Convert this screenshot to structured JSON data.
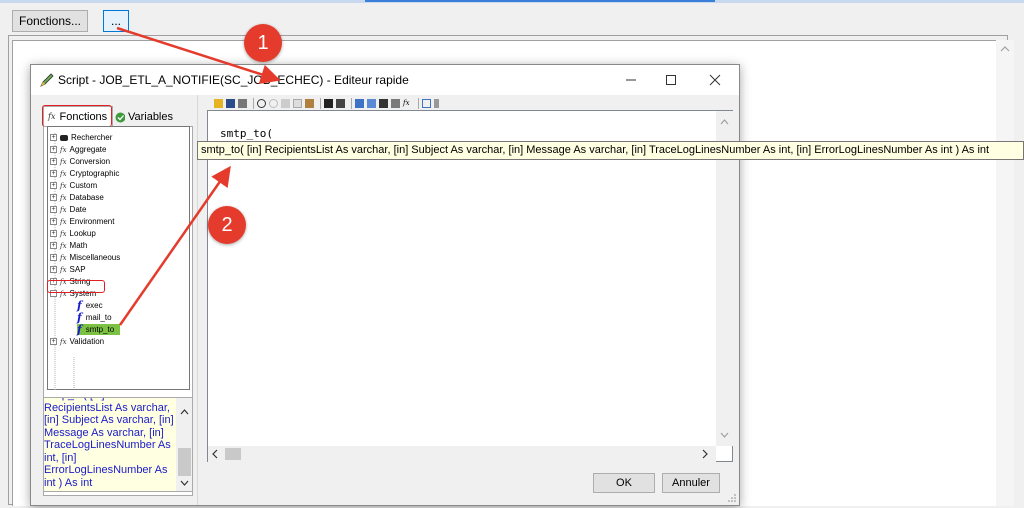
{
  "top": {
    "fonctions_button": "Fonctions...",
    "ellipsis_button": "..."
  },
  "dialog": {
    "title": "Script - JOB_ETL_A_NOTIFIE(SC_JOB_ECHEC) - Editeur rapide",
    "tabs": {
      "fonctions": "Fonctions",
      "variables": "Variables"
    },
    "tree": [
      {
        "label": "Rechercher",
        "icon": "binoculars-icon"
      },
      {
        "label": "Aggregate",
        "icon": "fx-icon"
      },
      {
        "label": "Conversion",
        "icon": "fx-icon"
      },
      {
        "label": "Cryptographic",
        "icon": "fx-icon"
      },
      {
        "label": "Custom",
        "icon": "fx-icon"
      },
      {
        "label": "Database",
        "icon": "fx-icon"
      },
      {
        "label": "Date",
        "icon": "fx-icon"
      },
      {
        "label": "Environment",
        "icon": "fx-icon"
      },
      {
        "label": "Lookup",
        "icon": "fx-icon"
      },
      {
        "label": "Math",
        "icon": "fx-icon"
      },
      {
        "label": "Miscellaneous",
        "icon": "fx-icon"
      },
      {
        "label": "SAP",
        "icon": "fx-icon"
      },
      {
        "label": "String",
        "icon": "fx-icon"
      },
      {
        "label": "System",
        "icon": "fx-icon"
      },
      {
        "label": "exec",
        "icon": "function-icon"
      },
      {
        "label": "mail_to",
        "icon": "function-icon"
      },
      {
        "label": "smtp_to",
        "icon": "function-icon"
      },
      {
        "label": "Validation",
        "icon": "fx-icon"
      }
    ],
    "description": "smtp_to( [in] RecipientsList As varchar, [in] Subject As varchar, [in] Message As varchar, [in] TraceLogLinesNumber As int, [in] ErrorLogLinesNumber As int ) As int",
    "editor_text": "smtp_to(",
    "tooltip": "smtp_to( [in] RecipientsList As varchar, [in] Subject As varchar, [in] Message As varchar, [in] TraceLogLinesNumber As int, [in] ErrorLogLinesNumber As int ) As int",
    "ok_label": "OK",
    "cancel_label": "Annuler"
  },
  "annotations": {
    "badge1": "1",
    "badge2": "2",
    "accent": "#e53b2c"
  }
}
